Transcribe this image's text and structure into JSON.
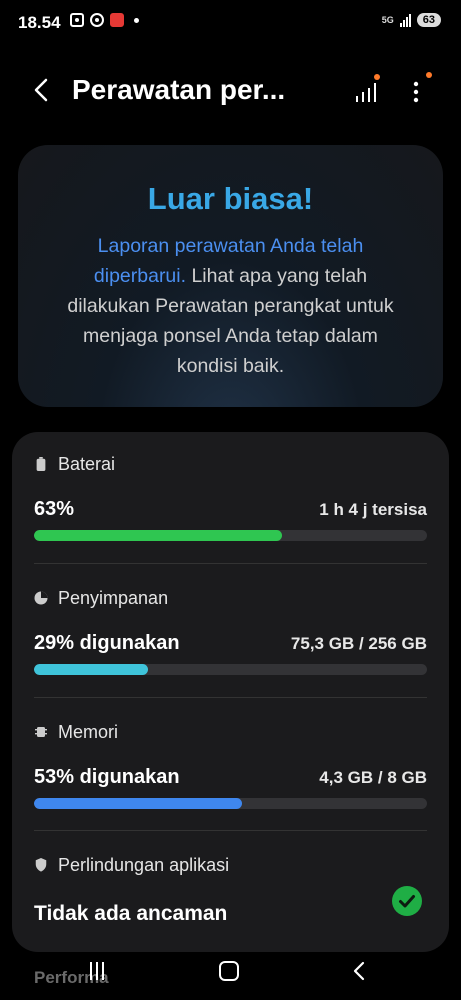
{
  "status_bar": {
    "time": "18.54",
    "network": "5G",
    "battery": "63"
  },
  "header": {
    "title": "Perawatan per...",
    "back_icon": "chevron-left-icon",
    "signal_icon": "bar-chart-icon",
    "more_icon": "more-vertical-icon"
  },
  "summary": {
    "title": "Luar biasa!",
    "link_text": "Laporan perawatan Anda telah diperbarui.",
    "description": " Lihat apa yang telah dilakukan Perawatan perangkat untuk menjaga ponsel Anda tetap dalam kondisi baik."
  },
  "battery": {
    "label": "Baterai",
    "value": "63%",
    "detail": "1 h 4 j tersisa",
    "level": 0.63,
    "color": "#2fc651"
  },
  "storage": {
    "label": "Penyimpanan",
    "value": "29% digunakan",
    "detail": "75,3 GB / 256 GB",
    "level": 0.29,
    "color": "#3fc4da"
  },
  "memory": {
    "label": "Memori",
    "value": "53% digunakan",
    "detail": "4,3 GB / 8 GB",
    "level": 0.53,
    "color": "#3f87ee"
  },
  "protection": {
    "label": "Perlindungan aplikasi",
    "status": "Tidak ada ancaman",
    "status_icon": "check-circle-icon"
  },
  "next_section_peek": "Performa"
}
